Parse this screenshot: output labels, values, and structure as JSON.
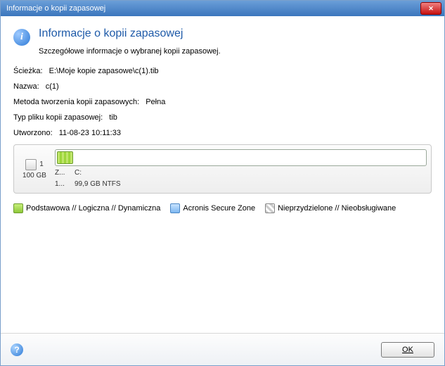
{
  "window": {
    "title": "Informacje o kopii zapasowej"
  },
  "header": {
    "heading": "Informacje o kopii zapasowej",
    "sub": "Szczegółowe informacje o wybranej kopii zapasowej."
  },
  "fields": {
    "path_label": "Ścieżka:",
    "path_value": "E:\\Moje kopie zapasowe\\c(1).tib",
    "name_label": "Nazwa:",
    "name_value": "c(1)",
    "method_label": "Metoda tworzenia kopii zapasowych:",
    "method_value": "Pełna",
    "filetype_label": "Typ pliku kopii zapasowej:",
    "filetype_value": "tib",
    "created_label": "Utworzono:",
    "created_value": "11-08-23 10:11:33"
  },
  "disk": {
    "index": "1",
    "capacity": "100 GB",
    "row1_left": "Z...",
    "row1_right": "C:",
    "row2_left": "1...",
    "row2_right": "99,9 GB  NTFS",
    "used_pct": 4
  },
  "legend": {
    "basic": "Podstawowa // Logiczna // Dynamiczna",
    "asz": "Acronis Secure Zone",
    "unalloc": "Nieprzydzielone // Nieobsługiwane"
  },
  "footer": {
    "ok": "OK"
  }
}
